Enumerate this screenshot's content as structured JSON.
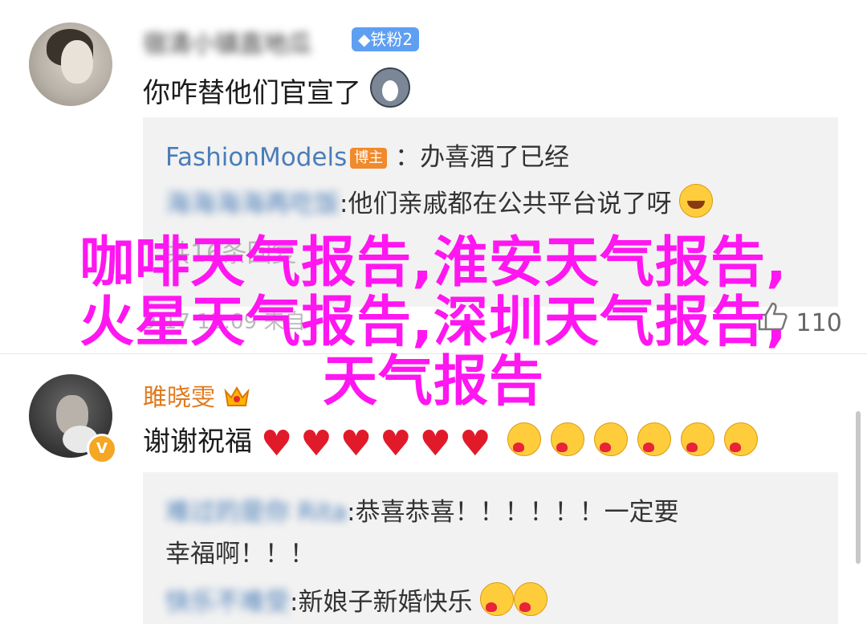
{
  "comment1": {
    "username": "宿清小镇直地瓜",
    "badge": "铁粉2",
    "text": "你咋替他们官宣了",
    "replies": [
      {
        "user": "FashionModels",
        "badge": "博主",
        "sep": "：",
        "text": "办喜酒了已经"
      },
      {
        "user": "海海海海再吃饭",
        "sep": ":",
        "text": "他们亲戚都在公共平台说了呀"
      }
    ],
    "more_replies": "共16条回复",
    "footer_time": "9-17 13:09 来自",
    "likes": "110"
  },
  "comment2": {
    "username": "雎晓雯",
    "text": "谢谢祝福",
    "heart_count": 6,
    "hug_count": 6,
    "replies": [
      {
        "user": "难过的是你 Rita",
        "sep": ":",
        "text": "恭喜恭喜！！！！！！一定要",
        "text2": "幸福啊！！！"
      },
      {
        "user": "快乐不难受",
        "sep": ":",
        "text": "新娘子新婚快乐"
      }
    ]
  },
  "overlay": {
    "line1": "咖啡天气报告,淮安天气报告,",
    "line2": "火星天气报告,深圳天气报告,",
    "line3": "天气报告",
    "color": "#ff16f0"
  },
  "colors": {
    "link": "#4a7db8",
    "badge_blue": "#5f9ff2",
    "badge_orange": "#f08a2c",
    "reply_bg": "#f2f2f2"
  },
  "icons": [
    "husky-emoji",
    "laugh-emoji",
    "heart-icon",
    "kiss-emoji",
    "crown-icon",
    "verified-icon",
    "thumbs-up-icon"
  ]
}
